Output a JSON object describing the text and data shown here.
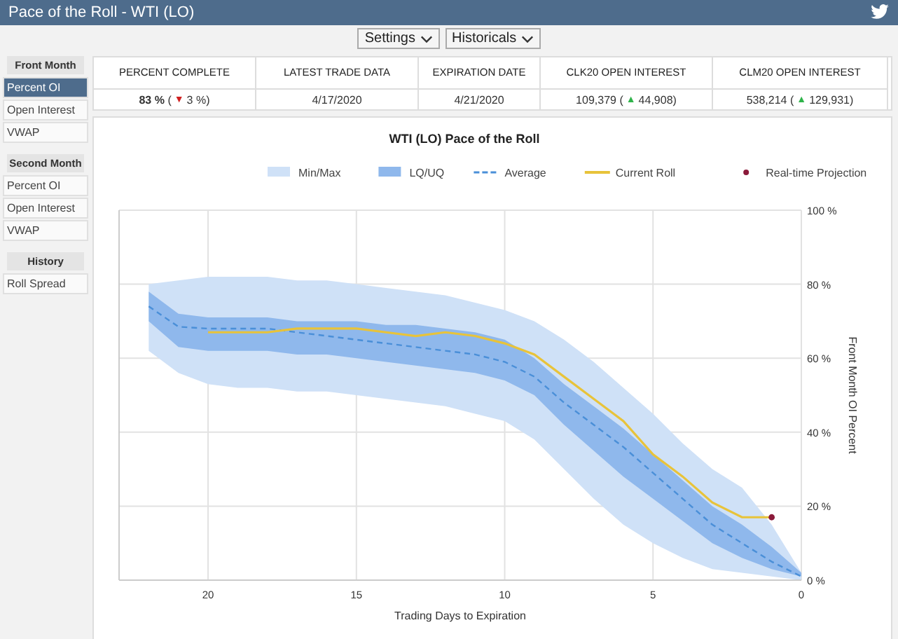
{
  "window": {
    "title": "Pace of the Roll - WTI (LO)"
  },
  "toolbar": [
    {
      "label": "Settings"
    },
    {
      "label": "Historicals"
    }
  ],
  "sidebar": [
    {
      "header": "Front Month",
      "items": [
        {
          "label": "Percent OI",
          "selected": true
        },
        {
          "label": "Open Interest",
          "selected": false
        },
        {
          "label": "VWAP",
          "selected": false
        }
      ]
    },
    {
      "header": "Second Month",
      "items": [
        {
          "label": "Percent OI",
          "selected": false
        },
        {
          "label": "Open Interest",
          "selected": false
        },
        {
          "label": "VWAP",
          "selected": false
        }
      ]
    },
    {
      "header": "History",
      "items": [
        {
          "label": "Roll Spread",
          "selected": false
        }
      ]
    }
  ],
  "summary": [
    {
      "heading": "PERCENT COMPLETE",
      "value": "**83 %** (",
      "arrow": "▼",
      "color": "#d02020",
      "change": "3 %)"
    },
    {
      "heading": "LATEST TRADE DATA",
      "value": "4/17/2020"
    },
    {
      "heading": "EXPIRATION DATE",
      "value": "4/21/2020"
    },
    {
      "heading": "CLK20 OPEN INTEREST",
      "value": "109,379 (",
      "arrow": "▲",
      "color": "#2fb34a",
      "change": "44,908)"
    },
    {
      "heading": "CLM20 OPEN INTEREST",
      "value": "538,214 (",
      "arrow": "▲",
      "color": "#2fb34a",
      "change": "129,931)"
    }
  ],
  "chart": {
    "envelopes": [
      {
        "label": "Min/Max",
        "color": "#cfe1f7"
      },
      {
        "label": "LQ/UQ",
        "color": "#8fb8ec"
      }
    ],
    "chart_data": {
      "type": "line",
      "title": "WTI (LO) Pace of the Roll",
      "xlabel": "Trading Days to Expiration",
      "ylabel": "Front Month OI Percent",
      "x": [
        22,
        21,
        20,
        19,
        18,
        17,
        16,
        15,
        14,
        13,
        12,
        11,
        10,
        9,
        8,
        7,
        6,
        5,
        4,
        3,
        2,
        1,
        0
      ],
      "xlim": [
        23,
        0
      ],
      "ylim": [
        0,
        100
      ],
      "xticks": [
        20,
        15,
        10,
        5,
        0
      ],
      "yticks": [
        {
          "value": 0,
          "label": "0 %"
        },
        {
          "value": 20,
          "label": "20 %"
        },
        {
          "value": 40,
          "label": "40 %"
        },
        {
          "value": 60,
          "label": "60 %"
        },
        {
          "value": 80,
          "label": "80 %"
        },
        {
          "value": 100,
          "label": "100 %"
        }
      ],
      "grid": true,
      "legend": true,
      "series": [
        {
          "name": "Average",
          "type": "line",
          "line_style": "dashed",
          "color": "#4a8fd8",
          "values": [
            74,
            68.5,
            68,
            68,
            68,
            67,
            66,
            65,
            64,
            63,
            62,
            61,
            59,
            55,
            48,
            42,
            36,
            29,
            22,
            15,
            10,
            5,
            1
          ]
        },
        {
          "name": "Current Roll",
          "type": "line",
          "line_style": "solid",
          "color": "#e8c33a",
          "values": [
            null,
            null,
            67,
            67,
            67,
            68,
            68,
            68,
            67,
            66,
            67,
            66,
            64,
            61,
            55,
            49,
            43,
            34,
            28,
            21,
            17,
            17,
            null
          ]
        },
        {
          "name": "Real-time Projection",
          "type": "scatter",
          "color": "#8b1a3a",
          "values": [
            null,
            null,
            null,
            null,
            null,
            null,
            null,
            null,
            null,
            null,
            null,
            null,
            null,
            null,
            null,
            null,
            null,
            null,
            null,
            null,
            null,
            17,
            null
          ]
        }
      ]
    }
  }
}
